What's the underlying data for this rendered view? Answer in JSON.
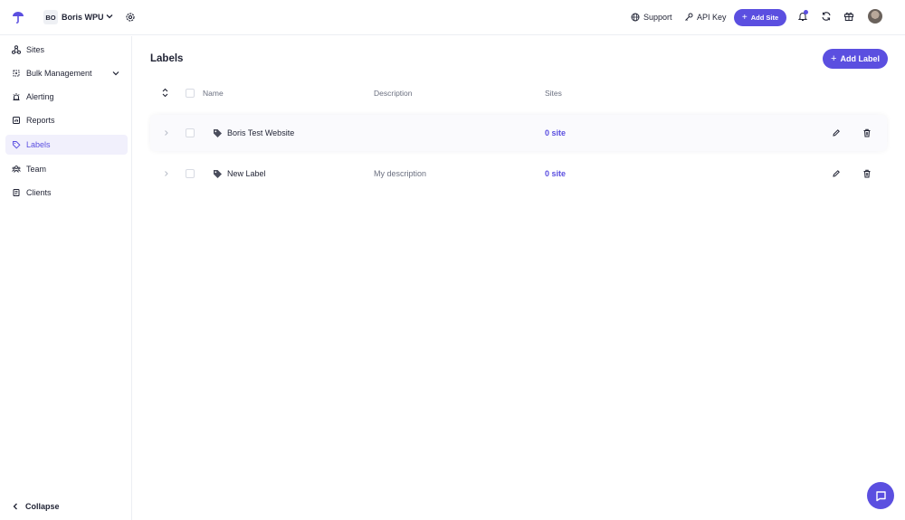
{
  "header": {
    "workspace_initials": "BO",
    "workspace_name": "Boris WPU",
    "support_label": "Support",
    "api_key_label": "API Key",
    "add_site_label": "Add Site"
  },
  "sidebar": {
    "items": [
      {
        "label": "Sites",
        "icon": "sites-icon"
      },
      {
        "label": "Bulk Management",
        "icon": "bulk-management-icon"
      },
      {
        "label": "Alerting",
        "icon": "alerting-icon"
      },
      {
        "label": "Reports",
        "icon": "reports-icon"
      },
      {
        "label": "Labels",
        "icon": "tag-icon"
      },
      {
        "label": "Team",
        "icon": "team-icon"
      },
      {
        "label": "Clients",
        "icon": "clients-icon"
      }
    ],
    "active": "Labels",
    "collapse_label": "Collapse"
  },
  "main": {
    "title": "Labels",
    "add_label_button": "Add Label",
    "columns": [
      "Name",
      "Description",
      "Sites"
    ],
    "rows": [
      {
        "name": "Boris Test Website",
        "description": "",
        "sites": "0 site"
      },
      {
        "name": "New Label",
        "description": "My description",
        "sites": "0 site"
      }
    ]
  },
  "colors": {
    "accent": "#5b4fe0",
    "active_bg": "#f1f0fc",
    "text": "#1f2233",
    "muted": "#6b7080",
    "border": "#eceef3"
  }
}
